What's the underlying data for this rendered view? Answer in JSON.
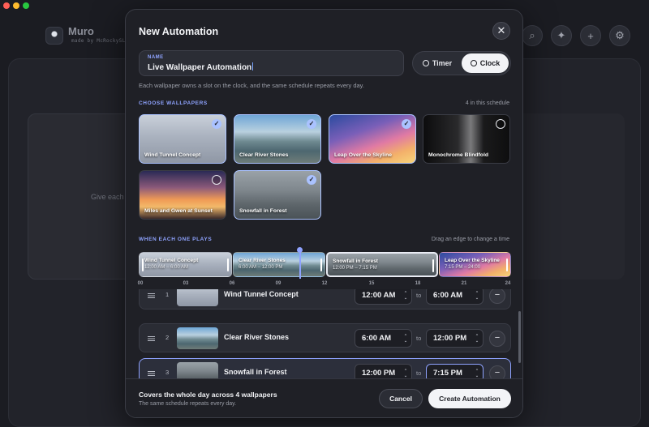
{
  "background": {
    "app_title": "Muro",
    "app_subtitle": "made by McRockySL",
    "card_hint": "Give each e"
  },
  "modal": {
    "title": "New Automation",
    "name_label": "NAME",
    "name_value": "Live Wallpaper Automation",
    "mode_timer": "Timer",
    "mode_clock": "Clock",
    "hint": "Each wallpaper owns a slot on the clock, and the same schedule repeats every day.",
    "choose_label": "CHOOSE WALLPAPERS",
    "choose_count": "4 in this schedule",
    "wallpapers": [
      {
        "name": "Wind Tunnel Concept",
        "selected": true
      },
      {
        "name": "Clear River Stones",
        "selected": true
      },
      {
        "name": "Leap Over the Skyline",
        "selected": true
      },
      {
        "name": "Monochrome Blindfold",
        "selected": false
      },
      {
        "name": "Miles and Gwen at Sunset",
        "selected": false
      },
      {
        "name": "Snowfall in Forest",
        "selected": true
      }
    ],
    "timeline_label": "WHEN EACH ONE PLAYS",
    "timeline_hint": "Drag an edge to change a time",
    "timeline": [
      {
        "name": "Wind Tunnel Concept",
        "range": "12:00 AM – 6:00 AM"
      },
      {
        "name": "Clear River Stones",
        "range": "6:00 AM – 12:00 PM"
      },
      {
        "name": "Snowfall in Forest",
        "range": "12:00 PM – 7:15 PM"
      },
      {
        "name": "Leap Over the Skyline",
        "range": "7:15 PM – 24:00"
      }
    ],
    "hour_ticks": [
      "00",
      "03",
      "06",
      "09",
      "12",
      "15",
      "18",
      "21",
      "24"
    ],
    "to_label": "to",
    "rows": [
      {
        "num": "1",
        "name": "Wind Tunnel Concept",
        "start": "12:00 AM",
        "end": "6:00 AM"
      },
      {
        "num": "2",
        "name": "Clear River Stones",
        "start": "6:00 AM",
        "end": "12:00 PM"
      },
      {
        "num": "3",
        "name": "Snowfall in Forest",
        "start": "12:00 PM",
        "end": "7:15 PM"
      }
    ],
    "footer_title": "Covers the whole day across 4 wallpapers",
    "footer_sub": "The same schedule repeats every day.",
    "cancel_label": "Cancel",
    "create_label": "Create Automation"
  },
  "colors": {
    "accent": "#8fa3ff",
    "selected_border": "#aac2ff",
    "background": "#16171c",
    "modal": "#1f2026"
  },
  "icons": {
    "close": "close-icon",
    "timer": "timer-icon",
    "clock": "clock-icon",
    "check": "check-icon",
    "drag": "drag-handle-icon",
    "remove": "minus-icon"
  }
}
